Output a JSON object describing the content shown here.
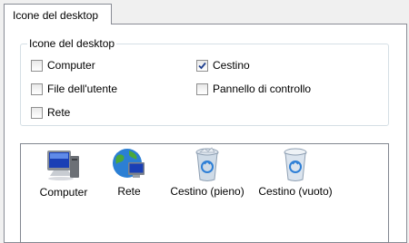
{
  "tab": {
    "label": "Icone del desktop"
  },
  "group": {
    "title": "Icone del desktop",
    "checkboxes": [
      {
        "label": "Computer",
        "checked": false
      },
      {
        "label": "Cestino",
        "checked": true
      },
      {
        "label": "File dell'utente",
        "checked": false
      },
      {
        "label": "Pannello di controllo",
        "checked": false
      },
      {
        "label": "Rete",
        "checked": false
      }
    ]
  },
  "icons": [
    {
      "label": "Computer",
      "icon": "computer-icon"
    },
    {
      "label": "Rete",
      "icon": "network-globe-icon"
    },
    {
      "label": "Cestino (pieno)",
      "icon": "recycle-bin-full-icon"
    },
    {
      "label": "Cestino (vuoto)",
      "icon": "recycle-bin-empty-icon"
    }
  ],
  "colors": {
    "check": "#1f3f8f",
    "border": "#898c95",
    "groupBorder": "#d5dfe5"
  }
}
